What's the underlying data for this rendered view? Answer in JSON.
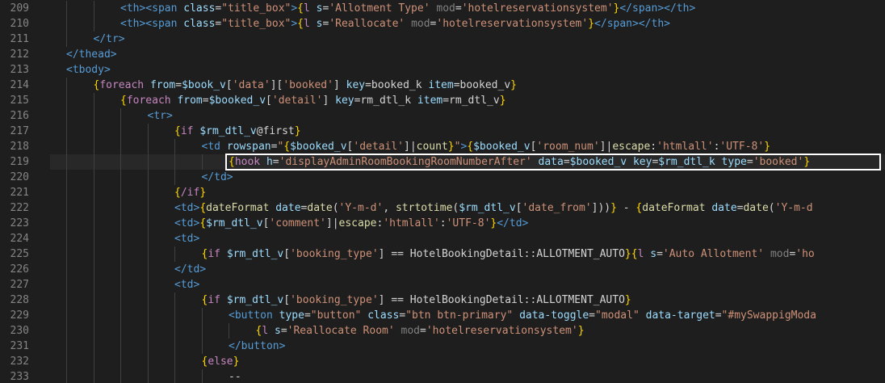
{
  "editor": {
    "background": "#1e1e1e",
    "current_line": 219,
    "highlight_color": "#ffffff",
    "lines": [
      {
        "n": "209",
        "indent": 2,
        "tokens": [
          [
            "tag",
            "<th><span "
          ],
          [
            "attr",
            "class"
          ],
          [
            "plain",
            "="
          ],
          [
            "str",
            "\"title_box\""
          ],
          [
            "tag",
            ">"
          ],
          [
            "brace",
            "{"
          ],
          [
            "kw",
            "l "
          ],
          [
            "attr",
            "s"
          ],
          [
            "plain",
            "="
          ],
          [
            "str",
            "'Allotment Type'"
          ],
          [
            "plain",
            " "
          ],
          [
            "dim",
            "mod"
          ],
          [
            "plain",
            "="
          ],
          [
            "str",
            "'hotelreservationsystem'"
          ],
          [
            "brace",
            "}"
          ],
          [
            "tag",
            "</span></th>"
          ]
        ]
      },
      {
        "n": "210",
        "indent": 2,
        "tokens": [
          [
            "tag",
            "<th><span "
          ],
          [
            "attr",
            "class"
          ],
          [
            "plain",
            "="
          ],
          [
            "str",
            "\"title_box\""
          ],
          [
            "tag",
            ">"
          ],
          [
            "brace",
            "{"
          ],
          [
            "kw",
            "l "
          ],
          [
            "attr",
            "s"
          ],
          [
            "plain",
            "="
          ],
          [
            "str",
            "'Reallocate'"
          ],
          [
            "plain",
            " "
          ],
          [
            "dim",
            "mod"
          ],
          [
            "plain",
            "="
          ],
          [
            "str",
            "'hotelreservationsystem'"
          ],
          [
            "brace",
            "}"
          ],
          [
            "tag",
            "</span></th>"
          ]
        ]
      },
      {
        "n": "211",
        "indent": 1,
        "tokens": [
          [
            "tag",
            "</tr>"
          ]
        ]
      },
      {
        "n": "212",
        "indent": 0,
        "tokens": [
          [
            "tag",
            "</thead>"
          ]
        ]
      },
      {
        "n": "213",
        "indent": 0,
        "tokens": [
          [
            "tag",
            "<tbody>"
          ]
        ]
      },
      {
        "n": "214",
        "indent": 1,
        "tokens": [
          [
            "brace",
            "{"
          ],
          [
            "kw",
            "foreach "
          ],
          [
            "attr",
            "from"
          ],
          [
            "plain",
            "="
          ],
          [
            "var",
            "$book_v"
          ],
          [
            "plain",
            "["
          ],
          [
            "str",
            "'data'"
          ],
          [
            "plain",
            "]["
          ],
          [
            "str",
            "'booked'"
          ],
          [
            "plain",
            "] "
          ],
          [
            "attr",
            "key"
          ],
          [
            "plain",
            "=booked_k "
          ],
          [
            "attr",
            "item"
          ],
          [
            "plain",
            "=booked_v"
          ],
          [
            "brace",
            "}"
          ]
        ]
      },
      {
        "n": "215",
        "indent": 2,
        "tokens": [
          [
            "brace",
            "{"
          ],
          [
            "kw",
            "foreach "
          ],
          [
            "attr",
            "from"
          ],
          [
            "plain",
            "="
          ],
          [
            "var",
            "$booked_v"
          ],
          [
            "plain",
            "["
          ],
          [
            "str",
            "'detail'"
          ],
          [
            "plain",
            "] "
          ],
          [
            "attr",
            "key"
          ],
          [
            "plain",
            "=rm_dtl_k "
          ],
          [
            "attr",
            "item"
          ],
          [
            "plain",
            "=rm_dtl_v"
          ],
          [
            "brace",
            "}"
          ]
        ]
      },
      {
        "n": "216",
        "indent": 3,
        "tokens": [
          [
            "tag",
            "<tr>"
          ]
        ]
      },
      {
        "n": "217",
        "indent": 4,
        "tokens": [
          [
            "brace",
            "{"
          ],
          [
            "kw",
            "if "
          ],
          [
            "var",
            "$rm_dtl_v"
          ],
          [
            "plain",
            "@first"
          ],
          [
            "brace",
            "}"
          ]
        ]
      },
      {
        "n": "218",
        "indent": 5,
        "tokens": [
          [
            "tag",
            "<td "
          ],
          [
            "attr",
            "rowspan"
          ],
          [
            "plain",
            "="
          ],
          [
            "str",
            "\""
          ],
          [
            "brace",
            "{"
          ],
          [
            "var",
            "$booked_v"
          ],
          [
            "plain",
            "["
          ],
          [
            "str",
            "'detail'"
          ],
          [
            "plain",
            "]|"
          ],
          [
            "fn",
            "count"
          ],
          [
            "brace",
            "}"
          ],
          [
            "str",
            "\""
          ],
          [
            "tag",
            ">"
          ],
          [
            "brace",
            "{"
          ],
          [
            "var",
            "$booked_v"
          ],
          [
            "plain",
            "["
          ],
          [
            "str",
            "'room_num'"
          ],
          [
            "plain",
            "]|"
          ],
          [
            "fn",
            "escape"
          ],
          [
            "plain",
            ":"
          ],
          [
            "str",
            "'htmlall'"
          ],
          [
            "plain",
            ":"
          ],
          [
            "str",
            "'UTF-8'"
          ],
          [
            "brace",
            "}"
          ]
        ]
      },
      {
        "n": "219",
        "indent": 6,
        "tokens": [
          [
            "brace",
            "{"
          ],
          [
            "kw",
            "hook "
          ],
          [
            "attr",
            "h"
          ],
          [
            "plain",
            "="
          ],
          [
            "str",
            "'displayAdminRoomBookingRoomNumberAfter'"
          ],
          [
            "plain",
            " "
          ],
          [
            "attr",
            "data"
          ],
          [
            "plain",
            "="
          ],
          [
            "var",
            "$booked_v"
          ],
          [
            "plain",
            " "
          ],
          [
            "attr",
            "key"
          ],
          [
            "plain",
            "="
          ],
          [
            "var",
            "$rm_dtl_k"
          ],
          [
            "plain",
            " "
          ],
          [
            "attr",
            "type"
          ],
          [
            "plain",
            "="
          ],
          [
            "str",
            "'booked'"
          ],
          [
            "brace",
            "}"
          ]
        ]
      },
      {
        "n": "220",
        "indent": 5,
        "tokens": [
          [
            "tag",
            "</td>"
          ]
        ]
      },
      {
        "n": "221",
        "indent": 4,
        "tokens": [
          [
            "brace",
            "{"
          ],
          [
            "kw",
            "/if"
          ],
          [
            "brace",
            "}"
          ]
        ]
      },
      {
        "n": "222",
        "indent": 4,
        "tokens": [
          [
            "tag",
            "<td>"
          ],
          [
            "brace",
            "{"
          ],
          [
            "fn",
            "dateFormat "
          ],
          [
            "attr",
            "date"
          ],
          [
            "plain",
            "="
          ],
          [
            "fn",
            "date"
          ],
          [
            "plain",
            "("
          ],
          [
            "str",
            "'Y-m-d'"
          ],
          [
            "plain",
            ", "
          ],
          [
            "fn",
            "strtotime"
          ],
          [
            "plain",
            "("
          ],
          [
            "var",
            "$rm_dtl_v"
          ],
          [
            "plain",
            "["
          ],
          [
            "str",
            "'date_from'"
          ],
          [
            "plain",
            "]))"
          ],
          [
            "brace",
            "}"
          ],
          [
            "plain",
            " - "
          ],
          [
            "brace",
            "{"
          ],
          [
            "fn",
            "dateFormat "
          ],
          [
            "attr",
            "date"
          ],
          [
            "plain",
            "="
          ],
          [
            "fn",
            "date"
          ],
          [
            "plain",
            "("
          ],
          [
            "str",
            "'Y-m-d"
          ]
        ]
      },
      {
        "n": "223",
        "indent": 4,
        "tokens": [
          [
            "tag",
            "<td>"
          ],
          [
            "brace",
            "{"
          ],
          [
            "var",
            "$rm_dtl_v"
          ],
          [
            "plain",
            "["
          ],
          [
            "str",
            "'comment'"
          ],
          [
            "plain",
            "]|"
          ],
          [
            "fn",
            "escape"
          ],
          [
            "plain",
            ":"
          ],
          [
            "str",
            "'htmlall'"
          ],
          [
            "plain",
            ":"
          ],
          [
            "str",
            "'UTF-8'"
          ],
          [
            "brace",
            "}"
          ],
          [
            "tag",
            "</td>"
          ]
        ]
      },
      {
        "n": "224",
        "indent": 4,
        "tokens": [
          [
            "tag",
            "<td>"
          ]
        ]
      },
      {
        "n": "225",
        "indent": 5,
        "tokens": [
          [
            "brace",
            "{"
          ],
          [
            "kw",
            "if "
          ],
          [
            "var",
            "$rm_dtl_v"
          ],
          [
            "plain",
            "["
          ],
          [
            "str",
            "'booking_type'"
          ],
          [
            "plain",
            "] == HotelBookingDetail::ALLOTMENT_AUTO"
          ],
          [
            "brace",
            "}{"
          ],
          [
            "kw",
            "l "
          ],
          [
            "attr",
            "s"
          ],
          [
            "plain",
            "="
          ],
          [
            "str",
            "'Auto Allotment'"
          ],
          [
            "plain",
            " "
          ],
          [
            "dim",
            "mod"
          ],
          [
            "plain",
            "="
          ],
          [
            "str",
            "'ho"
          ]
        ]
      },
      {
        "n": "226",
        "indent": 4,
        "tokens": [
          [
            "tag",
            "</td>"
          ]
        ]
      },
      {
        "n": "227",
        "indent": 4,
        "tokens": [
          [
            "tag",
            "<td>"
          ]
        ]
      },
      {
        "n": "228",
        "indent": 5,
        "tokens": [
          [
            "brace",
            "{"
          ],
          [
            "kw",
            "if "
          ],
          [
            "var",
            "$rm_dtl_v"
          ],
          [
            "plain",
            "["
          ],
          [
            "str",
            "'booking_type'"
          ],
          [
            "plain",
            "] == HotelBookingDetail::ALLOTMENT_AUTO"
          ],
          [
            "brace",
            "}"
          ]
        ]
      },
      {
        "n": "229",
        "indent": 6,
        "tokens": [
          [
            "tag",
            "<button "
          ],
          [
            "attr",
            "type"
          ],
          [
            "plain",
            "="
          ],
          [
            "str",
            "\"button\""
          ],
          [
            "plain",
            " "
          ],
          [
            "attr",
            "class"
          ],
          [
            "plain",
            "="
          ],
          [
            "str",
            "\"btn btn-primary\""
          ],
          [
            "plain",
            " "
          ],
          [
            "attr",
            "data-toggle"
          ],
          [
            "plain",
            "="
          ],
          [
            "str",
            "\"modal\""
          ],
          [
            "plain",
            " "
          ],
          [
            "attr",
            "data-target"
          ],
          [
            "plain",
            "="
          ],
          [
            "str",
            "\"#mySwappigModa"
          ]
        ]
      },
      {
        "n": "230",
        "indent": 7,
        "tokens": [
          [
            "brace",
            "{"
          ],
          [
            "kw",
            "l "
          ],
          [
            "attr",
            "s"
          ],
          [
            "plain",
            "="
          ],
          [
            "str",
            "'Reallocate Room'"
          ],
          [
            "plain",
            " "
          ],
          [
            "dim",
            "mod"
          ],
          [
            "plain",
            "="
          ],
          [
            "str",
            "'hotelreservationsystem'"
          ],
          [
            "brace",
            "}"
          ]
        ]
      },
      {
        "n": "231",
        "indent": 6,
        "tokens": [
          [
            "tag",
            "</button>"
          ]
        ]
      },
      {
        "n": "232",
        "indent": 5,
        "tokens": [
          [
            "brace",
            "{"
          ],
          [
            "kw",
            "else"
          ],
          [
            "brace",
            "}"
          ]
        ]
      },
      {
        "n": "233",
        "indent": 6,
        "tokens": [
          [
            "plain",
            "--"
          ]
        ]
      }
    ]
  }
}
